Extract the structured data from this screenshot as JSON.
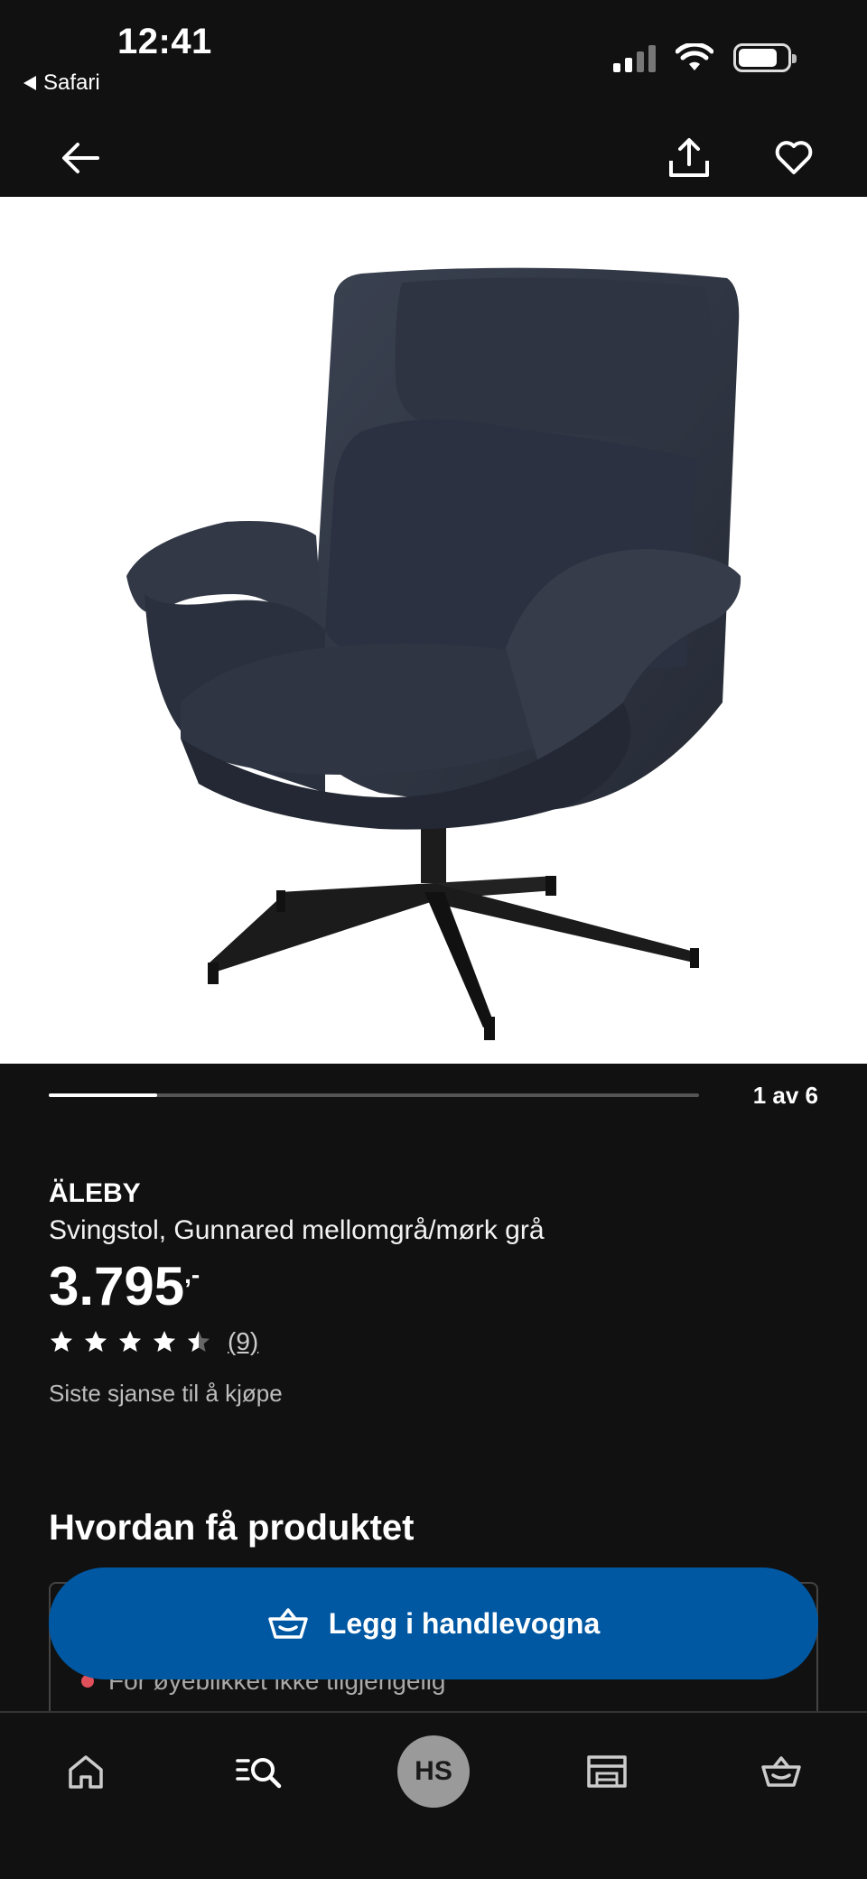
{
  "status_bar": {
    "time": "12:41",
    "back_app": "Safari",
    "icons": [
      "cellular-signal-icon",
      "wifi-icon",
      "battery-icon"
    ]
  },
  "nav": {
    "icons": [
      "back-arrow-icon",
      "share-icon",
      "heart-icon"
    ]
  },
  "product": {
    "image_icon": "swivel-armchair-image",
    "carousel": {
      "counter": "1 av 6",
      "current": 1,
      "total": 6
    },
    "brand": "ÄLEBY",
    "description": "Svingstol, Gunnared mellomgrå/mørk grå",
    "price": "3.795",
    "price_suffix": ",-",
    "rating": {
      "stars": 4.5,
      "max": 5,
      "count_label": "(9)"
    },
    "availability_note": "Siste sjanse til å kjøpe"
  },
  "delivery": {
    "section_title": "Hvordan få produktet",
    "status_text": "For øyeblikket ikke tilgjengelig",
    "status_color": "#e0505a"
  },
  "cart_button": {
    "label": "Legg i handlevogna",
    "icon": "basket-icon",
    "color": "#0058a3"
  },
  "tab_bar": {
    "tabs": [
      {
        "name": "home",
        "icon": "home-icon"
      },
      {
        "name": "search",
        "icon": "search-list-icon"
      },
      {
        "name": "profile",
        "icon": "avatar",
        "initials": "HS"
      },
      {
        "name": "stores",
        "icon": "store-icon"
      },
      {
        "name": "cart",
        "icon": "basket-icon"
      }
    ]
  }
}
